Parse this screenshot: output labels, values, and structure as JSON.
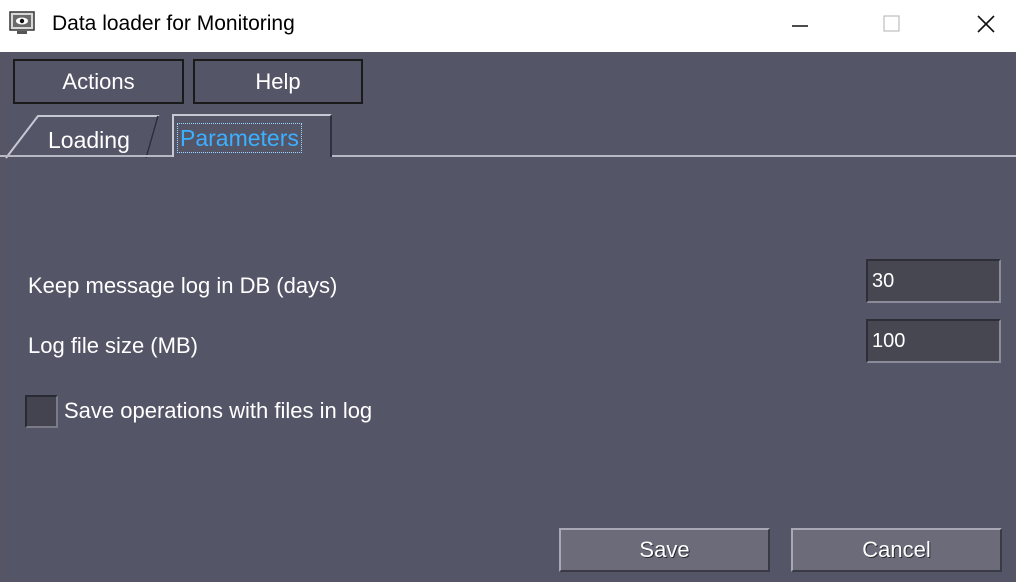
{
  "window": {
    "title": "Data loader for Monitoring",
    "icon": "app-monitor-icon",
    "controls": [
      "minimize-icon",
      "maximize-icon",
      "close-icon"
    ]
  },
  "menu": {
    "actions_label": "Actions",
    "help_label": "Help"
  },
  "tabs": [
    {
      "label": "Loading",
      "active": false
    },
    {
      "label": "Parameters",
      "active": true
    }
  ],
  "parameters": {
    "keep_log_label": "Keep message log in DB (days)",
    "keep_log_value": "30",
    "log_size_label": "Log file size (MB)",
    "log_size_value": "100",
    "save_ops_label": "Save operations with files in log",
    "save_ops_checked": false
  },
  "buttons": {
    "save_label": "Save",
    "cancel_label": "Cancel"
  },
  "colors": {
    "background": "#555568",
    "active_tab_text": "#3cb0ff",
    "text": "#ffffff"
  }
}
